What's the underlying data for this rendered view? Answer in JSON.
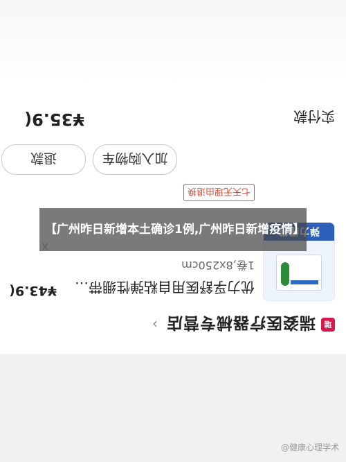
{
  "store": {
    "badge": "瑞",
    "name": "瑞姿医疗器械专营店"
  },
  "product": {
    "title": "优力孚舒医用自粘弹性绷带…",
    "price": "¥43.9(",
    "spec": "1卷,8x250cm",
    "qty": "x",
    "tag": "七天无理由退换",
    "image_brand": "弹力绷带"
  },
  "actions": {
    "add_to_cart": "加入购物车",
    "refund": "退款"
  },
  "payment": {
    "label": "实付款",
    "amount": "¥35.9("
  },
  "caption": {
    "text": "【广州昨日新增本土确诊1例,广州昨日新增疫情】"
  },
  "watermark": {
    "text": "@健康心理学术"
  },
  "colors": {
    "store_badge": "#d7194b",
    "tag": "#e1503b",
    "image_brand": "#2c5fb8"
  }
}
